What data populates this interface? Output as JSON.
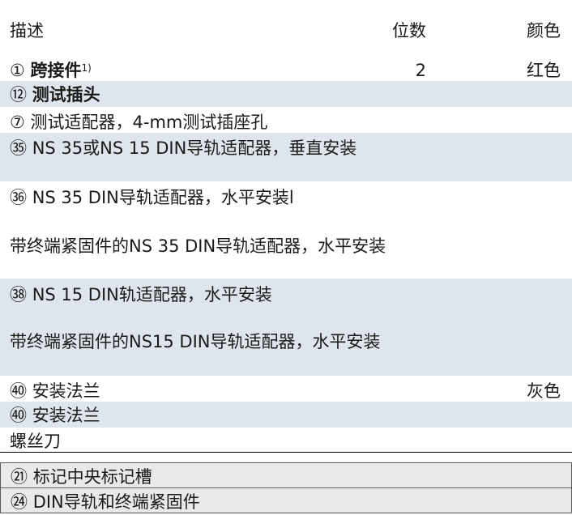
{
  "header": {
    "desc": "描述",
    "qty": "位数",
    "color": "颜色"
  },
  "rows": [
    {
      "marker": "①",
      "text": "跨接件",
      "sup": "1)",
      "qty": "2",
      "color": "红色"
    },
    {
      "marker": "⑫",
      "text": "测试插头"
    },
    {
      "marker": "⑦",
      "text": "测试适配器，4-mm测试插座孔"
    },
    {
      "marker": "㉟",
      "text": "NS 35或NS 15 DIN导轨适配器，垂直安装"
    },
    {
      "marker": "㊱",
      "text": "NS 35 DIN导轨适配器，水平安装l",
      "sub": "带终端紧固件的NS 35 DIN导轨适配器，水平安装"
    },
    {
      "marker": "㊳",
      "text": "NS 15 DIN轨适配器，水平安装",
      "sub": "带终端紧固件的NS15 DIN导轨适配器，水平安装"
    },
    {
      "marker": "㊵",
      "text": "安装法兰",
      "color": "灰色"
    },
    {
      "marker": "㊵",
      "text": "安装法兰"
    },
    {
      "text": "螺丝刀"
    }
  ],
  "boxed": [
    {
      "marker": "㉑",
      "text": "标记中央标记槽"
    },
    {
      "marker": "㉔",
      "text": "DIN导轨和终端紧固件"
    }
  ]
}
